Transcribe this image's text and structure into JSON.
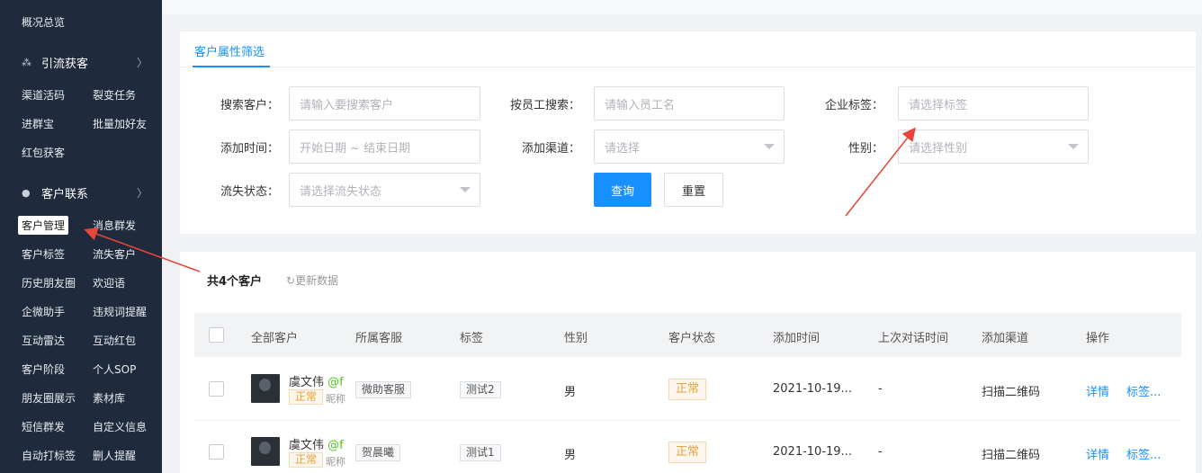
{
  "sidebar": {
    "overview": "概况总览",
    "group_traffic": {
      "label": "引流获客",
      "chevron": "〉"
    },
    "traffic_items": [
      "渠道活码",
      "裂变任务",
      "进群宝",
      "批量加好友",
      "红包获客"
    ],
    "group_customer": {
      "label": "客户联系",
      "chevron": "〉"
    },
    "customer_items": [
      "客户管理",
      "消息群发",
      "客户标签",
      "流失客户",
      "历史朋友圈",
      "欢迎语",
      "企微助手",
      "违规词提醒",
      "互动雷达",
      "互动红包",
      "客户阶段",
      "个人SOP",
      "朋友圈展示",
      "素材库",
      "短信群发",
      "自定义信息",
      "自动打标签",
      "删人提醒"
    ]
  },
  "filter": {
    "tab": "客户属性筛选",
    "search_customer": {
      "label": "搜索客户：",
      "placeholder": "请输入要搜索客户"
    },
    "search_employee": {
      "label": "按员工搜索：",
      "placeholder": "请输入员工名"
    },
    "company_tag": {
      "label": "企业标签：",
      "placeholder": "请选择标签"
    },
    "add_time": {
      "label": "添加时间：",
      "placeholder": "开始日期 ~ 结束日期"
    },
    "add_channel": {
      "label": "添加渠道：",
      "placeholder": "请选择"
    },
    "gender": {
      "label": "性别：",
      "placeholder": "请选择性别"
    },
    "churn_status": {
      "label": "流失状态：",
      "placeholder": "请选择流失状态"
    },
    "query_button": "查询",
    "reset_button": "重置"
  },
  "list": {
    "count": "共4个客户",
    "refresh": "更新数据",
    "refresh_icon": "↻",
    "columns": [
      "全部客户",
      "所属客服",
      "标签",
      "性别",
      "客户状态",
      "添加时间",
      "上次对话时间",
      "添加渠道",
      "操作"
    ],
    "rows": [
      {
        "name": "虞文伟",
        "at": "@f",
        "badge": "正常",
        "nick": "昵称",
        "service": "微助客服",
        "tag": "测试2",
        "gender": "男",
        "status": "正常",
        "add_time": "2021-10-19...",
        "last_chat": "-",
        "channel": "扫描二维码",
        "detail": "详情",
        "tags_link": "标签..."
      },
      {
        "name": "虞文伟",
        "at": "@f",
        "badge": "正常",
        "nick": "昵称",
        "service": "贺晨曦",
        "tag": "测试1",
        "gender": "男",
        "status": "正常",
        "add_time": "2021-10-19...",
        "last_chat": "-",
        "channel": "扫描二维码",
        "detail": "详情",
        "tags_link": "标签..."
      }
    ]
  },
  "colors": {
    "accent": "#1890ff",
    "sidebar_bg": "#1f2a3c",
    "warning": "#e6a23c",
    "annotation": "#e8463c"
  },
  "icons": {
    "traffic_group": "sitemap-icon",
    "customer_group": "user-icon",
    "select_caret": "caret-down-icon"
  }
}
